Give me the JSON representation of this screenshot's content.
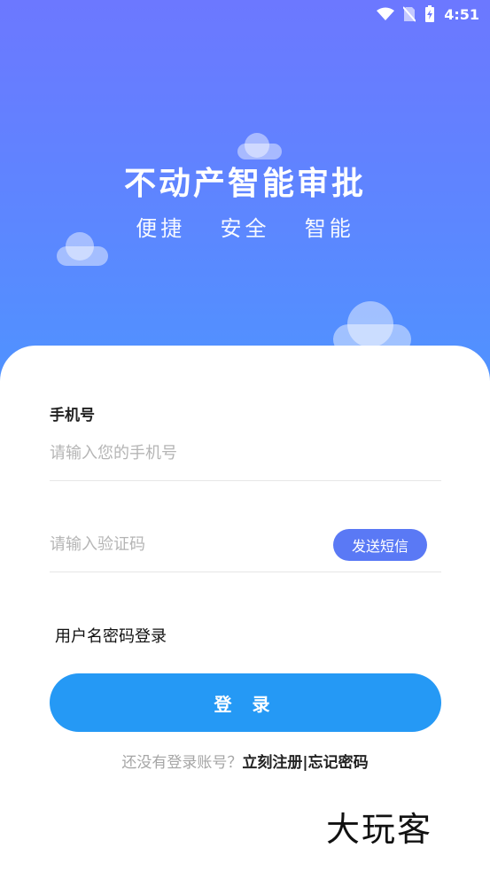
{
  "status_bar": {
    "time": "4:51",
    "icons": [
      "wifi-icon",
      "no-sim-icon",
      "battery-charging-icon"
    ]
  },
  "hero": {
    "title": "不动产智能审批",
    "subtitle": "便捷  安全  智能"
  },
  "form": {
    "phone_label": "手机号",
    "phone_placeholder": "请输入您的手机号",
    "code_placeholder": "请输入验证码",
    "send_sms_label": "发送短信",
    "alt_login_label": "用户名密码登录",
    "login_button": "登 录"
  },
  "footer": {
    "prompt": "还没有登录账号？",
    "register_link": "立刻注册",
    "separator": "|",
    "forgot_link": "忘记密码"
  },
  "watermark": "大玩客",
  "colors": {
    "hero_top": "#6c78ff",
    "hero_bottom": "#4f93ff",
    "sms_button": "#5a79f5",
    "login_button": "#2599f5"
  }
}
